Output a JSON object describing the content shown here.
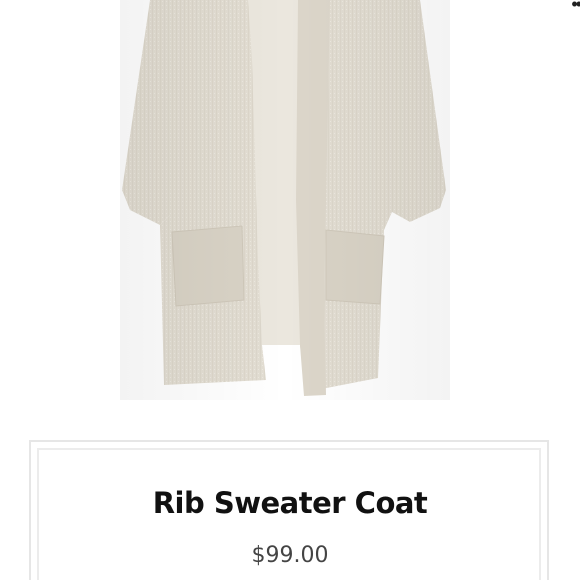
{
  "product": {
    "title": "Rib Sweater Coat",
    "price": "$99.00"
  },
  "colors": {
    "garment": "#e3ddd2",
    "background": "#ffffff",
    "title_text": "#111111",
    "price_text": "#444444"
  }
}
